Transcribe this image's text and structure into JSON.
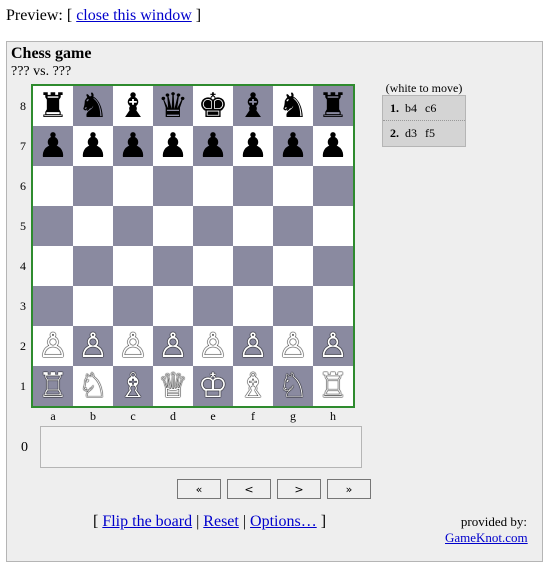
{
  "header": {
    "prefix": "Preview: [",
    "close_link": "close this window",
    "suffix": "]"
  },
  "game": {
    "title": "Chess game",
    "players": "??? vs. ???"
  },
  "board": {
    "ranks": [
      "8",
      "7",
      "6",
      "5",
      "4",
      "3",
      "2",
      "1"
    ],
    "files": [
      "a",
      "b",
      "c",
      "d",
      "e",
      "f",
      "g",
      "h"
    ],
    "rows": [
      [
        "♜",
        "♞",
        "♝",
        "♛",
        "♚",
        "♝",
        "♞",
        "♜"
      ],
      [
        "♟",
        "♟",
        "♟",
        "♟",
        "♟",
        "♟",
        "♟",
        "♟"
      ],
      [
        "",
        "",
        "",
        "",
        "",
        "",
        "",
        ""
      ],
      [
        "",
        "",
        "",
        "",
        "",
        "",
        "",
        ""
      ],
      [
        "",
        "",
        "",
        "",
        "",
        "",
        "",
        ""
      ],
      [
        "",
        "",
        "",
        "",
        "",
        "",
        "",
        ""
      ],
      [
        "♙",
        "♙",
        "♙",
        "♙",
        "♙",
        "♙",
        "♙",
        "♙"
      ],
      [
        "♖",
        "♘",
        "♗",
        "♕",
        "♔",
        "♗",
        "♘",
        "♖"
      ]
    ],
    "colors": {
      "light": "#ffffff",
      "dark": "#8a8aa0",
      "border": "#2e8b2e"
    }
  },
  "move_list": {
    "to_move": "(white to move)",
    "moves": [
      {
        "num": "1.",
        "white": "b4",
        "black": "c6"
      },
      {
        "num": "2.",
        "white": "d3",
        "black": "f5"
      }
    ]
  },
  "ply": {
    "number": "0"
  },
  "nav": {
    "first": "«",
    "prev": "<",
    "next": ">",
    "last": "»"
  },
  "links": {
    "open": "[",
    "flip": "Flip the board",
    "sep1": "|",
    "reset": "Reset",
    "sep2": "|",
    "options": "Options…",
    "close": "]"
  },
  "provided": {
    "label": "provided by:",
    "link": "GameKnot.com"
  }
}
